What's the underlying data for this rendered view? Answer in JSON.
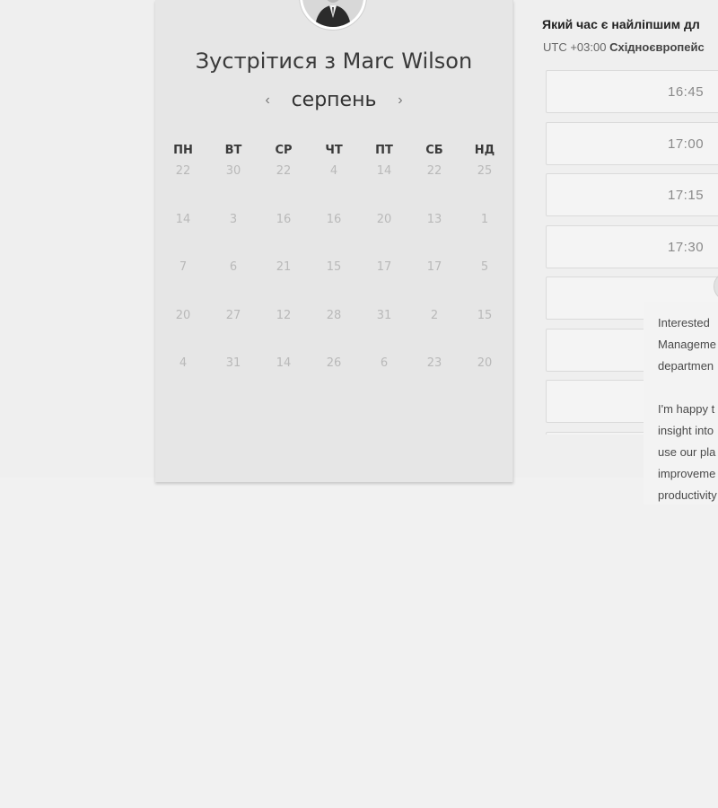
{
  "meeting": {
    "title": "Зустрітися з Marc Wilson"
  },
  "calendar": {
    "month": "серпень",
    "prev_icon": "‹",
    "next_icon": "›",
    "weekdays": [
      "ПН",
      "ВТ",
      "СР",
      "ЧТ",
      "ПТ",
      "СБ",
      "НД"
    ],
    "weeks": [
      [
        "22",
        "30",
        "22",
        "4",
        "14",
        "22",
        "25"
      ],
      [
        "14",
        "3",
        "16",
        "16",
        "20",
        "13",
        "1"
      ],
      [
        "7",
        "6",
        "21",
        "15",
        "17",
        "17",
        "5"
      ],
      [
        "20",
        "27",
        "12",
        "28",
        "31",
        "2",
        "15"
      ],
      [
        "4",
        "31",
        "14",
        "26",
        "6",
        "23",
        "20"
      ]
    ]
  },
  "times": {
    "question": "Який час є найліпшим дл",
    "timezone_offset": "UTC +03:00",
    "timezone_name": "Східноєвропейс",
    "slots": [
      {
        "label": "16:45"
      },
      {
        "label": "17:00"
      },
      {
        "label": "17:15"
      },
      {
        "label": "17:30"
      },
      {
        "label": ""
      },
      {
        "label": ""
      },
      {
        "label": ""
      },
      {
        "label": ""
      }
    ]
  },
  "chat": {
    "lines": [
      "Interested",
      "Manageme",
      "departmen",
      "",
      "I'm happy t",
      "insight into",
      "use our pla",
      "improveme",
      "productivity"
    ]
  },
  "colors": {
    "background": "#f1f1f1",
    "card": "#e6e6e6",
    "muted_day": "#b9b9b9",
    "slot_border": "#dadada"
  }
}
